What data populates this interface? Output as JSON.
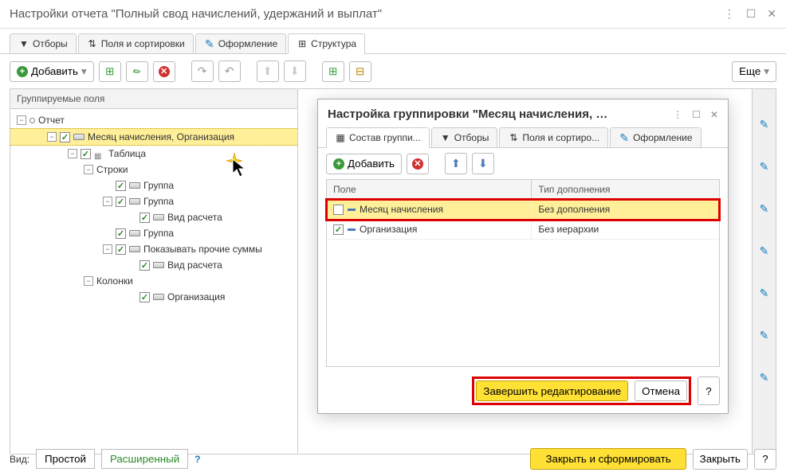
{
  "window": {
    "title": "Настройки отчета \"Полный свод начислений, удержаний и выплат\""
  },
  "tabs": {
    "filters": "Отборы",
    "fields": "Поля и сортировки",
    "format": "Оформление",
    "structure": "Структура"
  },
  "toolbar": {
    "add": "Добавить",
    "more": "Еще"
  },
  "left": {
    "header": "Группируемые поля",
    "report": "Отчет",
    "month_org": "Месяц начисления, Организация",
    "table": "Таблица",
    "rows": "Строки",
    "group": "Группа",
    "vid": "Вид расчета",
    "show_other": "Показывать прочие суммы",
    "columns": "Колонки",
    "org": "Организация"
  },
  "dialog": {
    "title": "Настройка группировки \"Месяц начисления, …",
    "tabs": {
      "compose": "Состав группи...",
      "filters": "Отборы",
      "fields": "Поля и сортиро...",
      "format": "Оформление"
    },
    "add": "Добавить",
    "grid": {
      "col_field": "Поле",
      "col_type": "Тип дополнения",
      "row1_field": "Месяц начисления",
      "row1_type": "Без дополнения",
      "row2_field": "Организация",
      "row2_type": "Без иерархии"
    },
    "finish": "Завершить редактирование",
    "cancel": "Отмена"
  },
  "footer": {
    "view": "Вид:",
    "simple": "Простой",
    "advanced": "Расширенный",
    "close_form": "Закрыть и сформировать",
    "close": "Закрыть"
  }
}
